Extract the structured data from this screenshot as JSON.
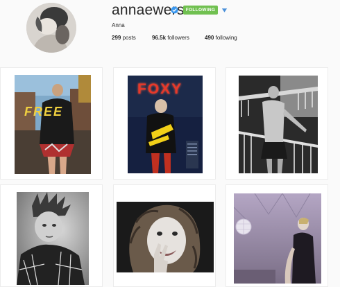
{
  "profile": {
    "username": "annaewers",
    "verified_icon": "verified-badge-icon",
    "follow_label": "FOLLOWING",
    "dropdown_icon": "caret-down-icon",
    "full_name": "Anna",
    "posts_count": "299",
    "posts_label": "posts",
    "followers_count": "96.5k",
    "followers_label": "followers",
    "following_count": "490",
    "following_label": "following"
  },
  "colors": {
    "following_button": "#70c050",
    "verified_badge": "#3897f0",
    "background": "#fafafa"
  },
  "posts": [
    {
      "id": "post-1",
      "magazine_text": "FREE"
    },
    {
      "id": "post-2",
      "magazine_text": "FOXY"
    },
    {
      "id": "post-3"
    },
    {
      "id": "post-4"
    },
    {
      "id": "post-5"
    },
    {
      "id": "post-6"
    }
  ]
}
